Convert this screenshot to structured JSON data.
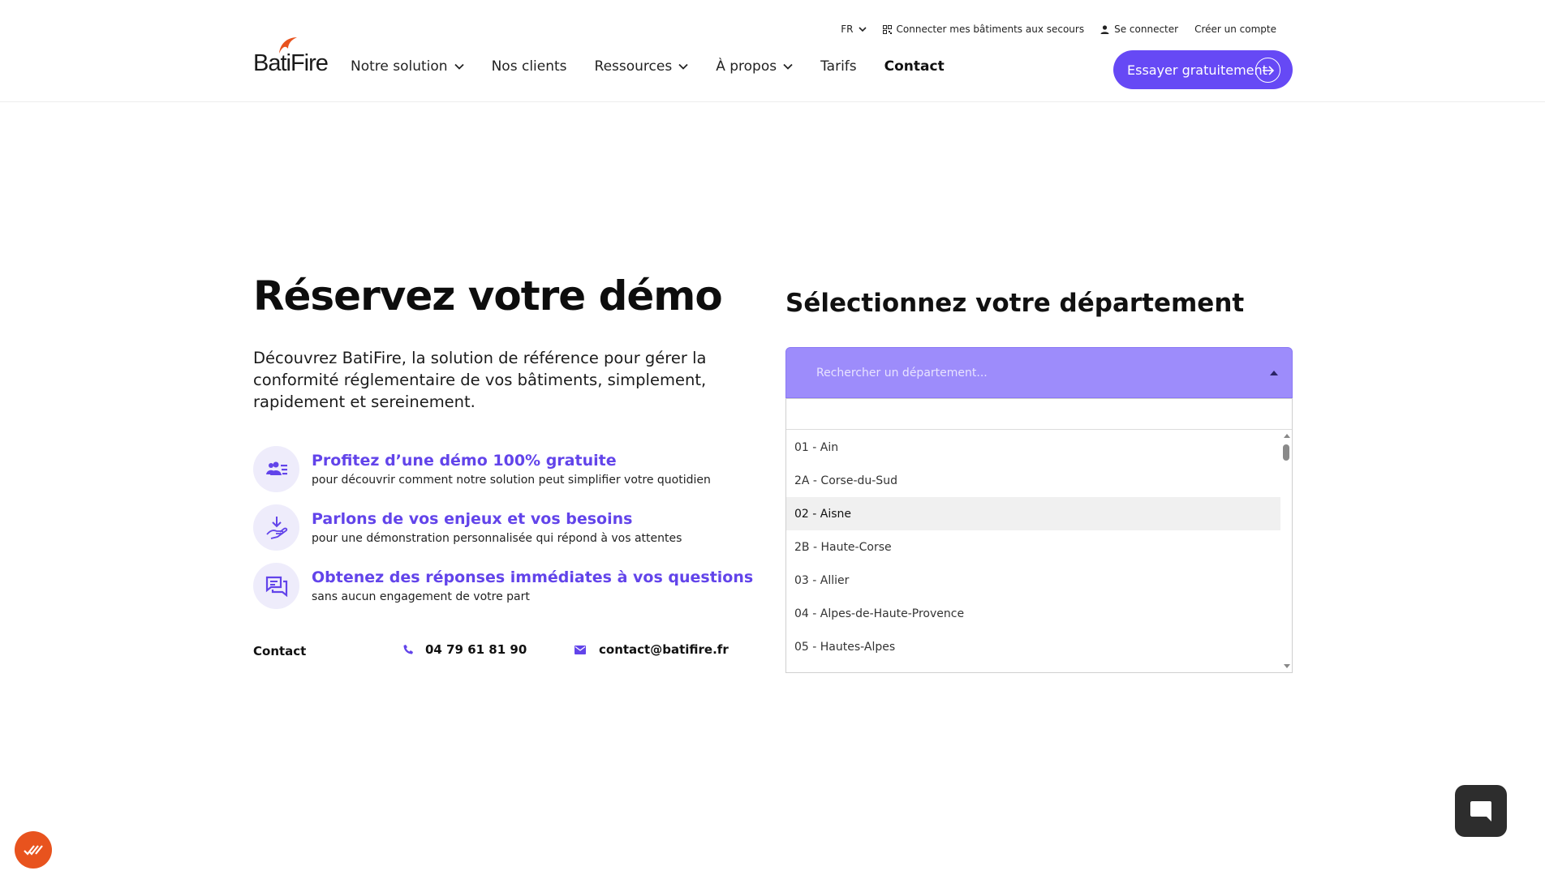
{
  "header": {
    "topbar": {
      "language": "FR",
      "connect_buildings": "Connecter mes bâtiments aux secours",
      "login": "Se connecter",
      "signup": "Créer un compte"
    },
    "logo_text": "BatiFire",
    "nav": [
      {
        "label": "Notre solution",
        "has_dropdown": true
      },
      {
        "label": "Nos clients",
        "has_dropdown": false
      },
      {
        "label": "Ressources",
        "has_dropdown": true
      },
      {
        "label": "À propos",
        "has_dropdown": true
      },
      {
        "label": "Tarifs",
        "has_dropdown": false
      },
      {
        "label": "Contact",
        "has_dropdown": false,
        "active": true
      }
    ],
    "cta_label": "Essayer gratuitement"
  },
  "hero": {
    "title": "Réservez votre démo",
    "description": "Découvrez BatiFire, la solution de référence pour gérer la conformité réglementaire de vos bâtiments, simplement, rapidement et sereinement."
  },
  "features": [
    {
      "icon": "users-list-icon",
      "title": "Profitez d’une démo 100% gratuite",
      "subtitle": "pour découvrir comment notre solution peut simplifier votre quotidien"
    },
    {
      "icon": "hand-download-icon",
      "title": "Parlons de vos enjeux et vos besoins",
      "subtitle": "pour une démonstration personnalisée qui répond à vos attentes"
    },
    {
      "icon": "chat-bubbles-icon",
      "title": "Obtenez des réponses immédiates à vos questions",
      "subtitle": "sans aucun engagement de votre part"
    }
  ],
  "contact": {
    "label": "Contact",
    "phone": "04 79 61 81 90",
    "email": "contact@batifire.fr"
  },
  "department": {
    "title": "Sélectionnez votre département",
    "placeholder": "Rechercher un département...",
    "search_value": "",
    "options": [
      "01 - Ain",
      "2A - Corse-du-Sud",
      "02 - Aisne",
      "2B - Haute-Corse",
      "03 - Allier",
      "04 - Alpes-de-Haute-Provence",
      "05 - Hautes-Alpes"
    ],
    "highlighted_index": 2
  },
  "colors": {
    "accent": "#6649f5",
    "accent_text": "#6244ea",
    "select_bg": "#9d8cfb",
    "icon_bg": "#eeecfb",
    "cookie": "#e8531e",
    "chat": "#2d2d2d"
  }
}
